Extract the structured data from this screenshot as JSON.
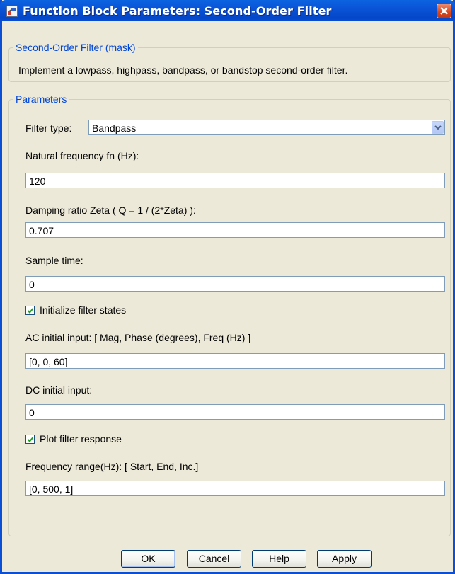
{
  "window": {
    "title": "Function Block Parameters: Second-Order Filter"
  },
  "mask": {
    "legend": "Second-Order Filter (mask)",
    "description": "Implement a lowpass, highpass, bandpass, or bandstop second-order filter."
  },
  "parameters": {
    "legend": "Parameters",
    "filter_type": {
      "label": "Filter type:",
      "value": "Bandpass"
    },
    "natural_frequency": {
      "label": "Natural frequency fn (Hz):",
      "value": "120"
    },
    "damping_ratio": {
      "label": "Damping ratio Zeta ( Q = 1 / (2*Zeta) ):",
      "value": "0.707"
    },
    "sample_time": {
      "label": "Sample time:",
      "value": "0"
    },
    "initialize_states": {
      "label": "Initialize filter states",
      "checked": true
    },
    "ac_initial_input": {
      "label": "AC initial input: [ Mag, Phase (degrees),  Freq (Hz) ]",
      "value": "[0,  0,  60]"
    },
    "dc_initial_input": {
      "label": "DC initial input:",
      "value": "0"
    },
    "plot_response": {
      "label": "Plot filter response",
      "checked": true
    },
    "frequency_range": {
      "label": "Frequency range(Hz): [ Start,  End,  Inc.]",
      "value": "[0, 500, 1]"
    }
  },
  "buttons": {
    "ok": "OK",
    "cancel": "Cancel",
    "help": "Help",
    "apply": "Apply"
  },
  "colors": {
    "titlebar": "#0a54d8",
    "legend_text": "#0046d5",
    "window_bg": "#ece9d8",
    "close_button": "#d7461f",
    "checkmark": "#21a121"
  },
  "icons": {
    "window": "simulink-block-icon",
    "close": "close-icon",
    "dropdown": "chevron-down-icon",
    "check": "checkmark-icon"
  }
}
